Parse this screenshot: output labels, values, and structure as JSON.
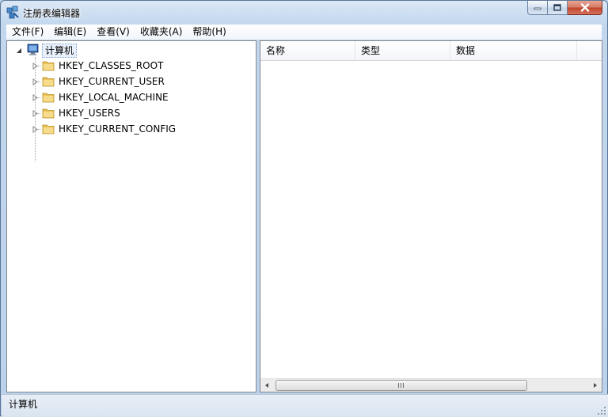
{
  "window": {
    "title": "注册表编辑器",
    "controls": {
      "minimize": "minimize",
      "maximize": "maximize",
      "close": "close"
    }
  },
  "menu": [
    "文件(F)",
    "编辑(E)",
    "查看(V)",
    "收藏夹(A)",
    "帮助(H)"
  ],
  "tree": {
    "root": "计算机",
    "children": [
      "HKEY_CLASSES_ROOT",
      "HKEY_CURRENT_USER",
      "HKEY_LOCAL_MACHINE",
      "HKEY_USERS",
      "HKEY_CURRENT_CONFIG"
    ]
  },
  "list": {
    "columns": [
      "名称",
      "类型",
      "数据"
    ],
    "scroll_grip": "III"
  },
  "status": {
    "path": "计算机"
  },
  "colors": {
    "folder": "#e8c25a",
    "accent": "#7da2ce",
    "close_button": "#c2432a"
  },
  "icons": {
    "app": "registry-app-icon",
    "computer": "computer-icon",
    "folder": "folder-icon",
    "expand": "triangle-right-icon",
    "collapse": "triangle-down-icon"
  }
}
